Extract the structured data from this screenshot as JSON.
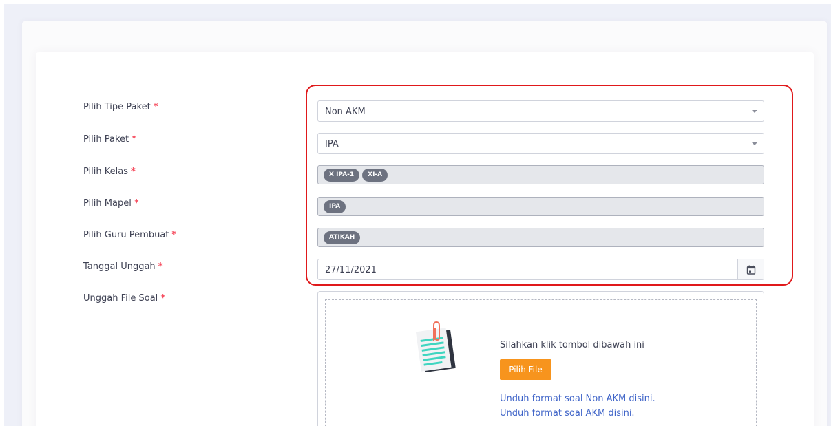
{
  "form": {
    "fields": [
      {
        "label": "Pilih Tipe Paket",
        "required": "*"
      },
      {
        "label": "Pilih Paket",
        "required": "*"
      },
      {
        "label": "Pilih Kelas",
        "required": "*"
      },
      {
        "label": "Pilih Mapel",
        "required": "*"
      },
      {
        "label": "Pilih Guru Pembuat",
        "required": "*"
      },
      {
        "label": "Tanggal Unggah",
        "required": "*"
      },
      {
        "label": "Unggah File Soal",
        "required": "*"
      }
    ],
    "tipe_paket": {
      "selected": "Non AKM"
    },
    "paket": {
      "selected": "IPA"
    },
    "kelas": {
      "chips": [
        "X IPA-1",
        "XI-A"
      ]
    },
    "mapel": {
      "chips": [
        "IPA"
      ]
    },
    "guru": {
      "chips": [
        "ATIKAH"
      ]
    },
    "tanggal": {
      "value": "27/11/2021",
      "icon": "calendar-icon"
    },
    "upload": {
      "instruction": "Silahkan klik tombol dibawah ini",
      "button_label": "Pilih File",
      "link_non_akm": "Unduh format soal Non AKM disini.",
      "link_akm": "Unduh format soal AKM disini.",
      "icon": "document-clip-icon"
    }
  },
  "colors": {
    "accent_button": "#f7941d",
    "link": "#3f64c8",
    "required_mark": "#f64e60",
    "highlight_border": "#e0191b",
    "chip": "#6d7280"
  }
}
